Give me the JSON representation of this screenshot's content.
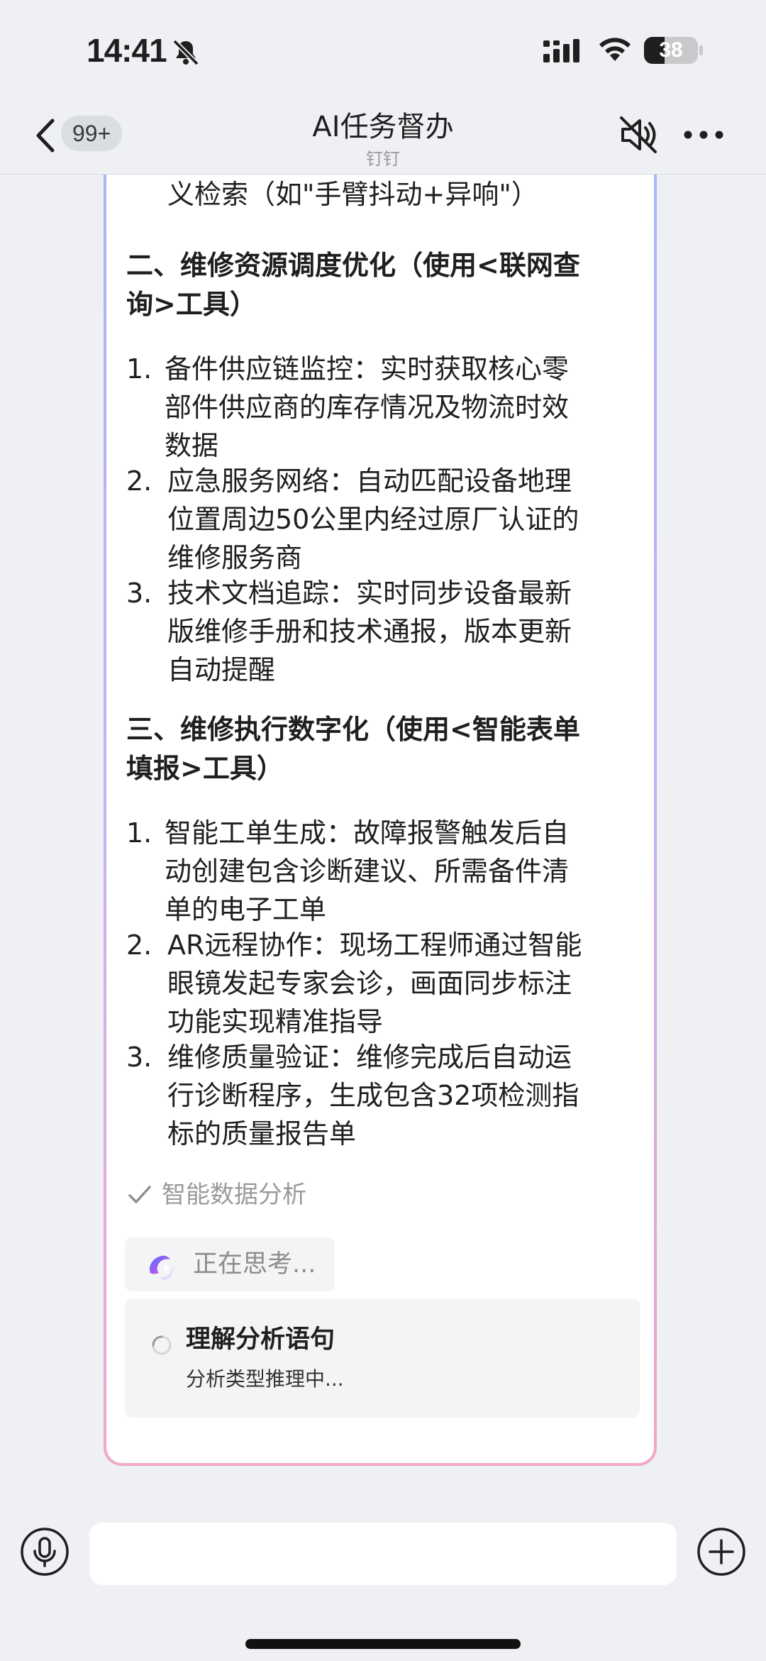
{
  "status_bar": {
    "time": "14:41",
    "battery_level": "38",
    "icons": [
      "bell-slash-icon",
      "signal-icon",
      "wifi-icon",
      "battery-icon"
    ]
  },
  "nav": {
    "back_icon": "chevron-left-icon",
    "badge": "99+",
    "title": "AI任务督办",
    "subtitle": "钉钉",
    "mute_icon": "speaker-muted-icon",
    "more_icon": "more-dots-icon"
  },
  "message": {
    "cut_line": "义检索（如\"手臂抖动+异响\"）",
    "sections": [
      {
        "heading_lines": [
          "二、维修资源调度优化（使用<联网查",
          "询>工具）"
        ],
        "items": [
          {
            "num": "1.",
            "lines": [
              "备件供应链监控：实时获取核心零",
              "部件供应商的库存情况及物流时效",
              "数据"
            ]
          },
          {
            "num": "2.",
            "lines": [
              "应急服务网络：自动匹配设备地理",
              "位置周边50公里内经过原厂认证的",
              "维修服务商"
            ]
          },
          {
            "num": "3.",
            "lines": [
              "技术文档追踪：实时同步设备最新",
              "版维修手册和技术通报，版本更新",
              "自动提醒"
            ]
          }
        ]
      },
      {
        "heading_lines": [
          "三、维修执行数字化（使用<智能表单",
          "填报>工具）"
        ],
        "items": [
          {
            "num": "1.",
            "lines": [
              "智能工单生成：故障报警触发后自",
              "动创建包含诊断建议、所需备件清",
              "单的电子工单"
            ]
          },
          {
            "num": "2.",
            "lines": [
              "AR远程协作：现场工程师通过智能",
              "眼镜发起专家会诊，画面同步标注",
              "功能实现精准指导"
            ]
          },
          {
            "num": "3.",
            "lines": [
              "维修质量验证：维修完成后自动运",
              "行诊断程序，生成包含32项检测指",
              "标的质量报告单"
            ]
          }
        ]
      }
    ],
    "done_step": "智能数据分析",
    "thinking_label": "正在思考...",
    "current_step": {
      "title": "理解分析语句",
      "desc": "分析类型推理中..."
    }
  },
  "bottom": {
    "voice_icon": "microphone-icon",
    "input_value": "",
    "input_placeholder": "",
    "plus_icon": "plus-circle-icon"
  },
  "colors": {
    "background": "#eef0f3",
    "card_border_top": "#a9b7f5",
    "card_border_bottom": "#f0a8c8"
  }
}
